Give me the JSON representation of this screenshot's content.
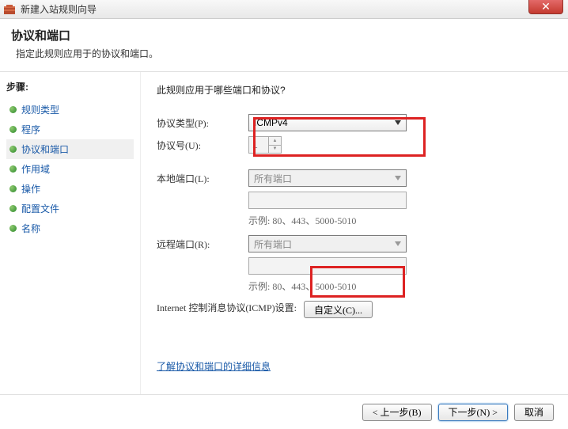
{
  "window": {
    "title": "新建入站规则向导",
    "close_glyph": "✕"
  },
  "header": {
    "title": "协议和端口",
    "subtitle": "指定此规则应用于的协议和端口。"
  },
  "sidebar": {
    "title": "步骤:",
    "items": [
      {
        "label": "规则类型"
      },
      {
        "label": "程序"
      },
      {
        "label": "协议和端口"
      },
      {
        "label": "作用域"
      },
      {
        "label": "操作"
      },
      {
        "label": "配置文件"
      },
      {
        "label": "名称"
      }
    ]
  },
  "content": {
    "question": "此规则应用于哪些端口和协议?",
    "protocol_type_label": "协议类型(P):",
    "protocol_type_value": "ICMPv4",
    "protocol_num_label": "协议号(U):",
    "protocol_num_value": "1",
    "local_port_label": "本地端口(L):",
    "local_port_value": "所有端口",
    "local_port_example": "示例: 80、443、5000-5010",
    "remote_port_label": "远程端口(R):",
    "remote_port_value": "所有端口",
    "remote_port_example": "示例: 80、443、5000-5010",
    "icmp_label": "Internet 控制消息协议(ICMP)设置:",
    "customize_btn": "自定义(C)...",
    "learn_more": "了解协议和端口的详细信息"
  },
  "footer": {
    "back": "< 上一步(B)",
    "next": "下一步(N) >",
    "cancel": "取消"
  }
}
